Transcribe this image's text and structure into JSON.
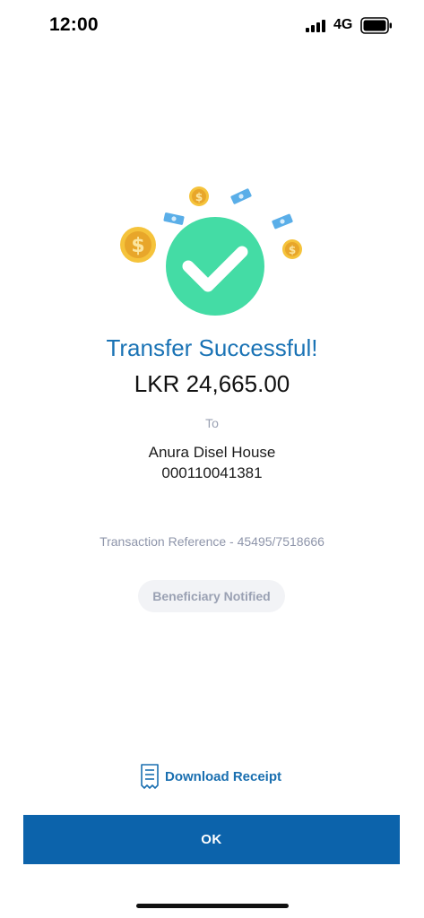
{
  "status_bar": {
    "time": "12:00",
    "network": "4G",
    "signal_icon": "cellular-signal-icon",
    "battery_icon": "battery-icon"
  },
  "illustration": {
    "success_icon": "checkmark-circle-icon",
    "decorations": [
      "dollar-coin-icon",
      "banknote-icon"
    ],
    "colors": {
      "success_green": "#44dca5",
      "coin_gold": "#f5c33b",
      "coin_dark": "#e39a1c",
      "banknote_blue": "#5aaee8"
    }
  },
  "result": {
    "title": "Transfer Successful!",
    "amount": "LKR 24,665.00",
    "to_label": "To",
    "beneficiary_name": "Anura Disel House",
    "beneficiary_account": "000110041381",
    "reference": "Transaction Reference - 45495/7518666",
    "notified_badge": "Beneficiary Notified"
  },
  "actions": {
    "download_receipt": "Download Receipt",
    "download_icon": "receipt-icon",
    "ok": "OK"
  },
  "colors": {
    "accent_blue": "#1a73b5",
    "button_blue": "#0c63ab",
    "muted_text": "#9aa1b3"
  }
}
